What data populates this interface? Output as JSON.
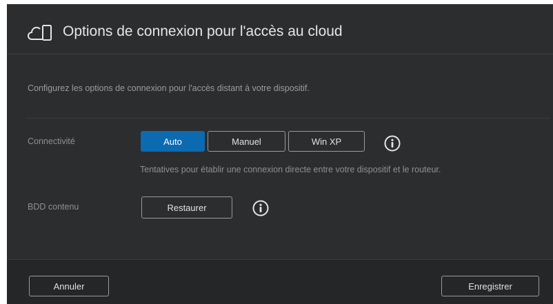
{
  "header": {
    "icon": "cloud-device-icon",
    "title": "Options de connexion pour l'accès au cloud"
  },
  "description": "Configurez les options de connexion pour l'accès distant à votre dispositif.",
  "connectivity": {
    "label": "Connectivité",
    "options": [
      {
        "label": "Auto",
        "selected": true
      },
      {
        "label": "Manuel",
        "selected": false
      },
      {
        "label": "Win XP",
        "selected": false
      }
    ],
    "info_icon": "info-icon",
    "hint": "Tentatives pour établir une connexion directe entre votre dispositif et le routeur."
  },
  "content_db": {
    "label": "BDD contenu",
    "button_label": "Restaurer",
    "info_icon": "info-icon"
  },
  "footer": {
    "cancel_label": "Annuler",
    "save_label": "Enregistrer"
  },
  "colors": {
    "dialog_bg": "#2c2d2f",
    "footer_bg": "#252628",
    "accent": "#0c6ab0"
  }
}
